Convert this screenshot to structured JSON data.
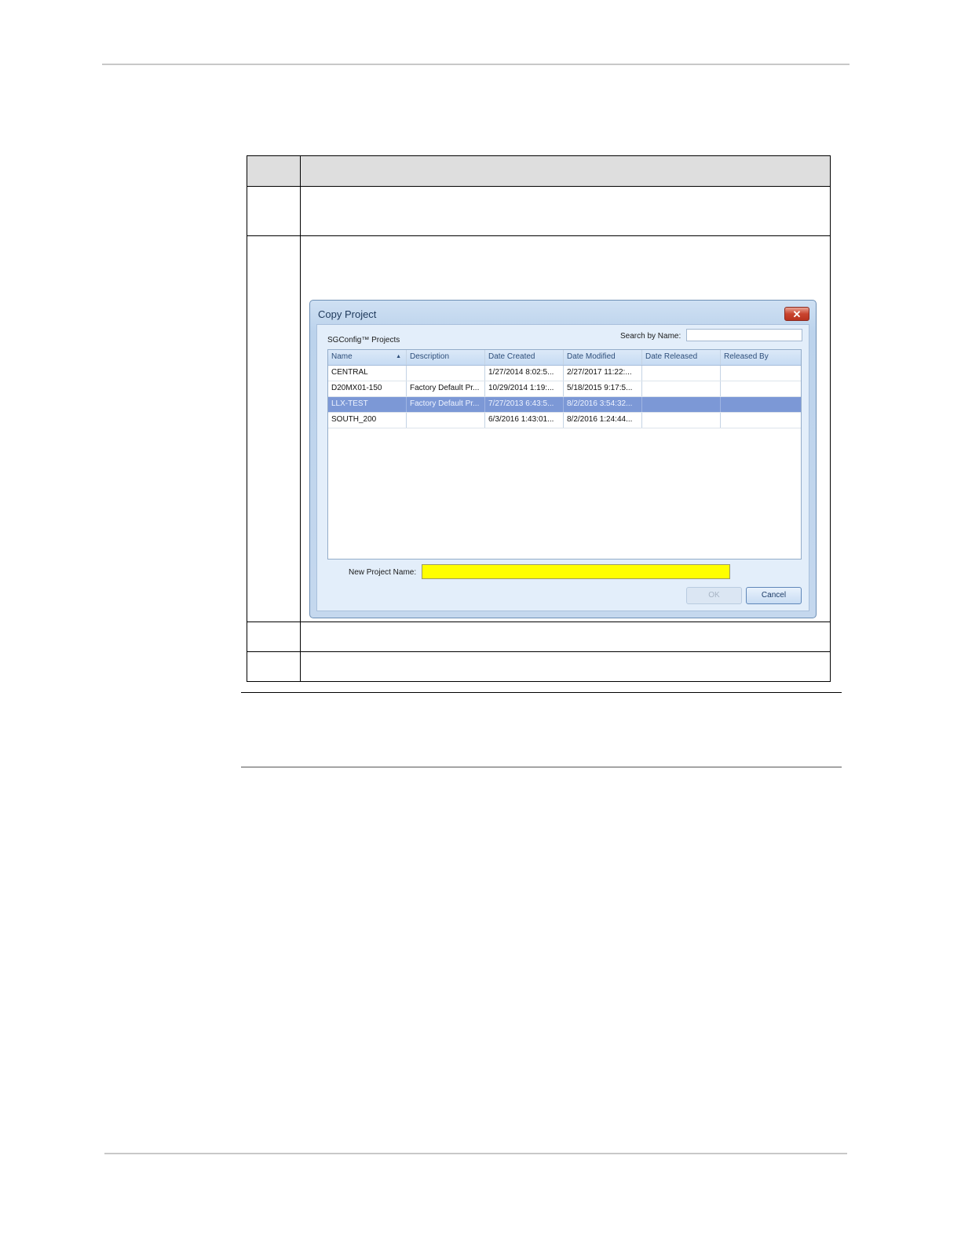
{
  "dialog": {
    "title": "Copy Project",
    "close_glyph": "✕",
    "projects_label": "SGConfig™ Projects",
    "search_label": "Search by Name:",
    "search_value": "",
    "columns": [
      "Name",
      "Description",
      "Date Created",
      "Date Modified",
      "Date Released",
      "Released By"
    ],
    "sort_indicator": "▲",
    "rows": [
      [
        "CENTRAL",
        "",
        "1/27/2014 8:02:5...",
        "2/27/2017 11:22:...",
        "",
        ""
      ],
      [
        "D20MX01-150",
        "Factory Default Pr...",
        "10/29/2014 1:19:...",
        "5/18/2015 9:17:5...",
        "",
        ""
      ],
      [
        "LLX-TEST",
        "Factory Default Pr...",
        "7/27/2013 6:43:5...",
        "8/2/2016 3:54:32...",
        "",
        ""
      ],
      [
        "SOUTH_200",
        "",
        "6/3/2016 1:43:01...",
        "8/2/2016 1:24:44...",
        "",
        ""
      ]
    ],
    "selected_row": 2,
    "new_name_label": "New Project Name:",
    "new_name_value": "",
    "ok_label": "OK",
    "cancel_label": "Cancel",
    "colors": {
      "selected_row": "#7c98d6",
      "highlight_field": "#ffff00",
      "close_button": "#c9442f"
    }
  }
}
